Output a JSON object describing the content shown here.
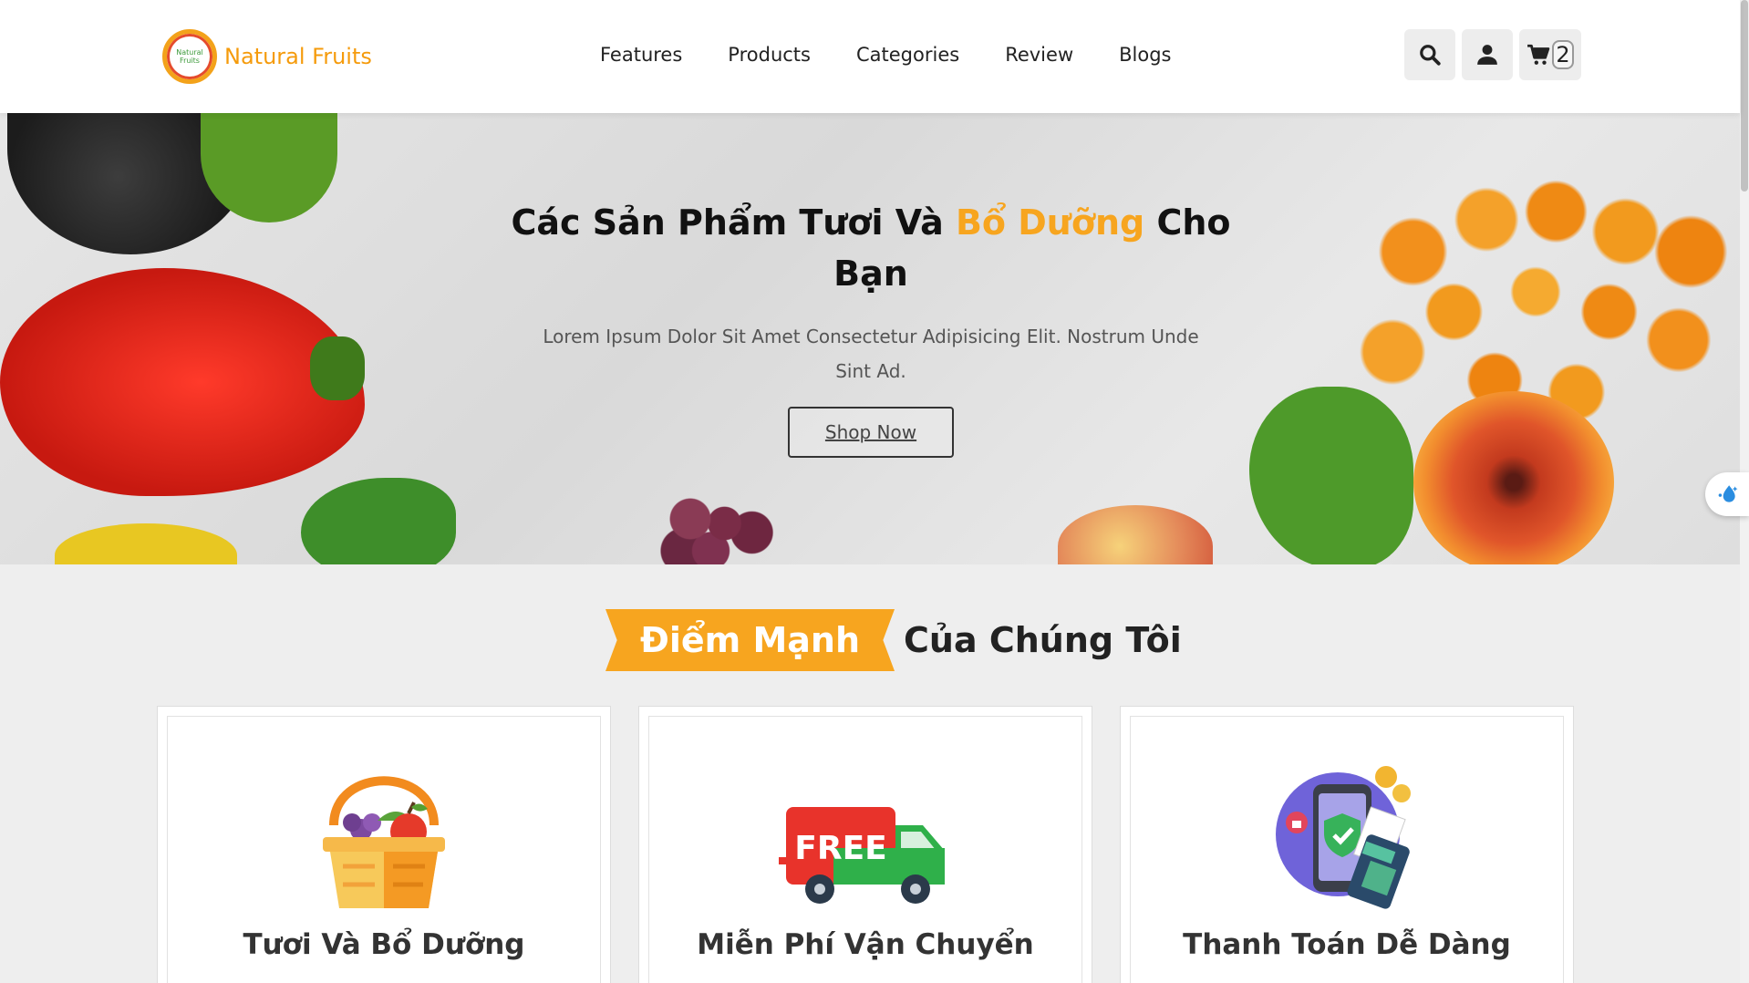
{
  "header": {
    "logo_badge_text": "Natural Fruits",
    "logo_text": "Natural Fruits",
    "nav": [
      "Features",
      "Products",
      "Categories",
      "Review",
      "Blogs"
    ],
    "cart_count": "2",
    "icons": [
      "search-icon",
      "user-icon",
      "cart-icon"
    ]
  },
  "hero": {
    "title_part1": "Các Sản Phẩm Tươi Và ",
    "title_highlight": "Bổ Dưỡng",
    "title_part2": " Cho Bạn",
    "description": "Lorem Ipsum Dolor Sit Amet Consectetur Adipisicing Elit. Nostrum Unde Sint Ad.",
    "button_label": "Shop Now"
  },
  "strengths": {
    "ribbon_text": "Điểm Mạnh",
    "title_rest": "Của Chúng Tôi",
    "cards": [
      {
        "title": "Tươi Và Bổ Dưỡng",
        "icon": "fruit-basket-icon"
      },
      {
        "title": "Miễn Phí Vận Chuyển",
        "icon": "free-delivery-truck-icon",
        "icon_text": "FREE"
      },
      {
        "title": "Thanh Toán Dễ Dàng",
        "icon": "mobile-payment-icon"
      }
    ]
  },
  "colors": {
    "accent": "#f7a51f",
    "logo_text": "#f59b0c",
    "background": "#eeeeee"
  }
}
